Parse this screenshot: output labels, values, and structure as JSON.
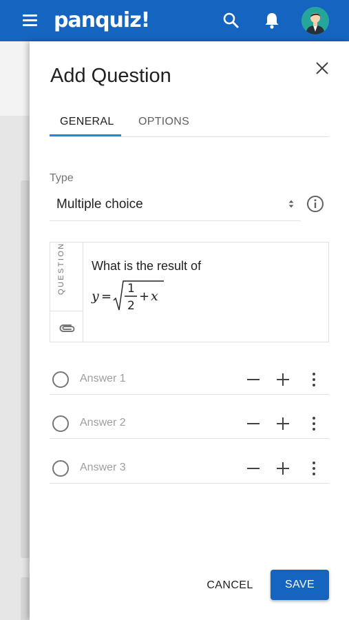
{
  "app": {
    "logo": "panquiz!",
    "icons": [
      "menu-icon",
      "search-icon",
      "bell-icon",
      "avatar-icon"
    ],
    "brand_color": "#1565c0"
  },
  "panel": {
    "title": "Add Question",
    "tabs": [
      {
        "label": "GENERAL",
        "active": true
      },
      {
        "label": "OPTIONS",
        "active": false
      }
    ],
    "type_label": "Type",
    "type_value": "Multiple choice",
    "question_label": "QUESTION",
    "question_text": "What is the result of",
    "formula": {
      "lhs": "y",
      "equals": "=",
      "numerator": "1",
      "denominator": "2",
      "plus": "+",
      "var": "x"
    },
    "answers": [
      {
        "placeholder": "Answer 1"
      },
      {
        "placeholder": "Answer 2"
      },
      {
        "placeholder": "Answer 3"
      }
    ],
    "cancel_label": "CANCEL",
    "save_label": "SAVE"
  }
}
